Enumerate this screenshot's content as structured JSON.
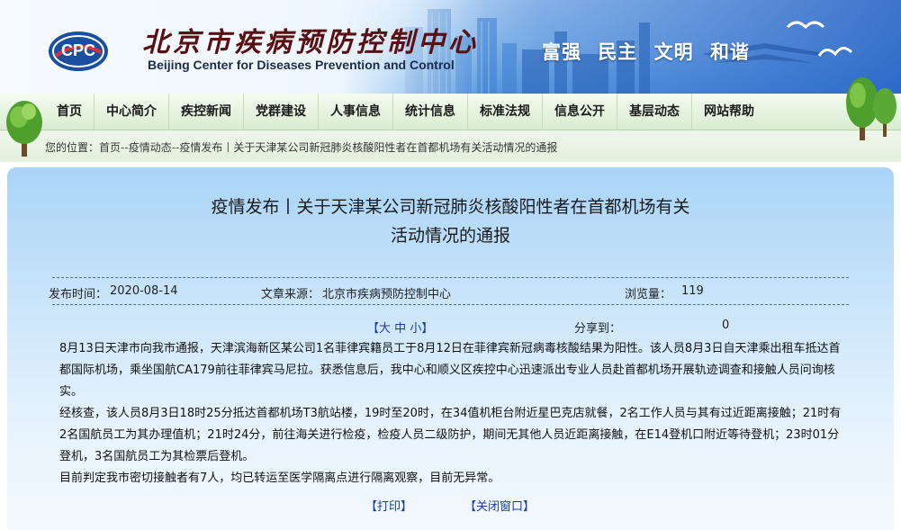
{
  "header": {
    "title_cn": "北京市疾病预防控制中心",
    "title_en": "Beijing Center for Diseases Prevention and Control",
    "logo_text": "CPC",
    "slogan": [
      "富强",
      "民主",
      "文明",
      "和谐"
    ],
    "colors": {
      "title": "#5a1010",
      "sky": "#5fa3e4"
    }
  },
  "nav": {
    "items": [
      "首页",
      "中心简介",
      "疾控新闻",
      "党群建设",
      "人事信息",
      "统计信息",
      "标准法规",
      "信息公开",
      "基层动态",
      "网站帮助"
    ]
  },
  "breadcrumb": {
    "prefix": "您的位置：",
    "items": [
      "首页",
      "疫情动态",
      "疫情发布"
    ],
    "separator": "--",
    "current": "关于天津某公司新冠肺炎核酸阳性者在首都机场有关活动情况的通报",
    "current_divider": "丨"
  },
  "article": {
    "title_line1": "疫情发布丨关于天津某公司新冠肺炎核酸阳性者在首都机场有关",
    "title_line2": "活动情况的通报",
    "publish_label": "发布时间：",
    "publish_date": "2020-08-14",
    "source_label": "文章来源：",
    "source": "北京市疾病预防控制中心",
    "views_label": "浏览量：",
    "views": "119",
    "font_switch": {
      "open": "【",
      "large": "大",
      "medium": "中",
      "small": "小",
      "close": "】"
    },
    "share_label": "分享到：",
    "share_count": "0",
    "paragraphs": [
      "8月13日天津市向我市通报，天津滨海新区某公司1名菲律宾籍员工于8月12日在菲律宾新冠病毒核酸结果为阳性。该人员8月3日自天津乘出租车抵达首都国际机场，乘坐国航CA179前往菲律宾马尼拉。获悉信息后，我中心和顺义区疾控中心迅速派出专业人员赴首都机场开展轨迹调查和接触人员问询核实。",
      "经核查，该人员8月3日18时25分抵达首都机场T3航站楼，19时至20时，在34值机柜台附近星巴克店就餐，2名工作人员与其有过近距离接触；21时有2名国航员工为其办理值机；21时24分，前往海关进行检疫，检疫人员二级防护，期间无其他人员近距离接触，在E14登机口附近等待登机；23时01分登机，3名国航员工为其检票后登机。",
      "目前判定我市密切接触者有7人，均已转运至医学隔离点进行隔离观察，目前无异常。"
    ],
    "print_label": "【打印】",
    "close_label": "【关闭窗口】"
  }
}
